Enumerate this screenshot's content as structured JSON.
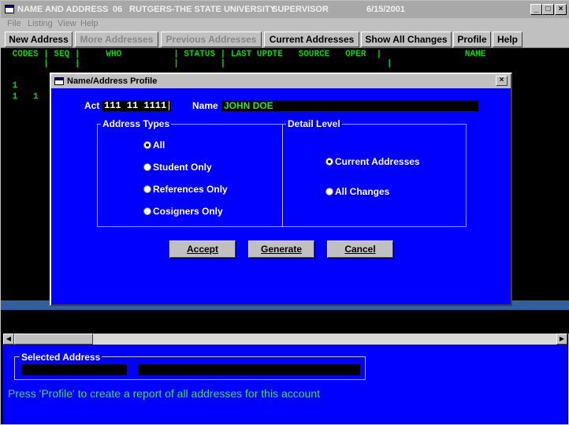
{
  "window": {
    "title_app": "NAME AND ADDRESS",
    "title_code": "06",
    "title_org": "RUTGERS-THE STATE UNIVERSITY",
    "title_role": "SUPERVISOR",
    "title_date": "6/15/2001",
    "min": "_",
    "max": "□",
    "close": "×"
  },
  "menu": [
    "File",
    "Listing",
    "View",
    "Help"
  ],
  "toolbar": [
    {
      "label": "New Address",
      "enabled": true
    },
    {
      "label": "More Addresses",
      "enabled": false
    },
    {
      "label": "Previous Addresses",
      "enabled": false
    },
    {
      "label": "Current Addresses",
      "enabled": true
    },
    {
      "label": "Show All Changes",
      "enabled": true
    },
    {
      "label": "Profile",
      "enabled": true
    },
    {
      "label": "Help",
      "enabled": true
    }
  ],
  "terminal": {
    "header": " CODES | SEQ |     WHO          | STATUS | LAST UPDTE   SOURCE   OPER  |                NAME",
    "header2": "       |     |                  |        |                               |",
    "row1": " 1    ",
    "row2": " 1   1"
  },
  "dialog": {
    "title": "Name/Address Profile",
    "close": "×",
    "act_label": "Act",
    "act_value": "111 11 1111",
    "name_label": "Name",
    "name_value": "JOHN DOE",
    "address_types": {
      "legend": "Address Types",
      "options": [
        "All",
        "Student Only",
        "References Only",
        "Cosigners Only"
      ],
      "selected": "All"
    },
    "detail_level": {
      "legend": "Detail Level",
      "options": [
        "Current Addresses",
        "All Changes"
      ],
      "selected": "Current Addresses"
    },
    "buttons": {
      "accept": "Accept",
      "generate": "Generate",
      "cancel": "Cancel"
    }
  },
  "scrollbar": {
    "left": "◀",
    "right": "▶"
  },
  "bottom": {
    "selected_label": "Selected Address",
    "status": "Press 'Profile' to create a report of all addresses for this account"
  },
  "colors": {
    "accent_blue": "#0000ff",
    "terminal_green": "#10d010",
    "status_green": "#40e040"
  }
}
